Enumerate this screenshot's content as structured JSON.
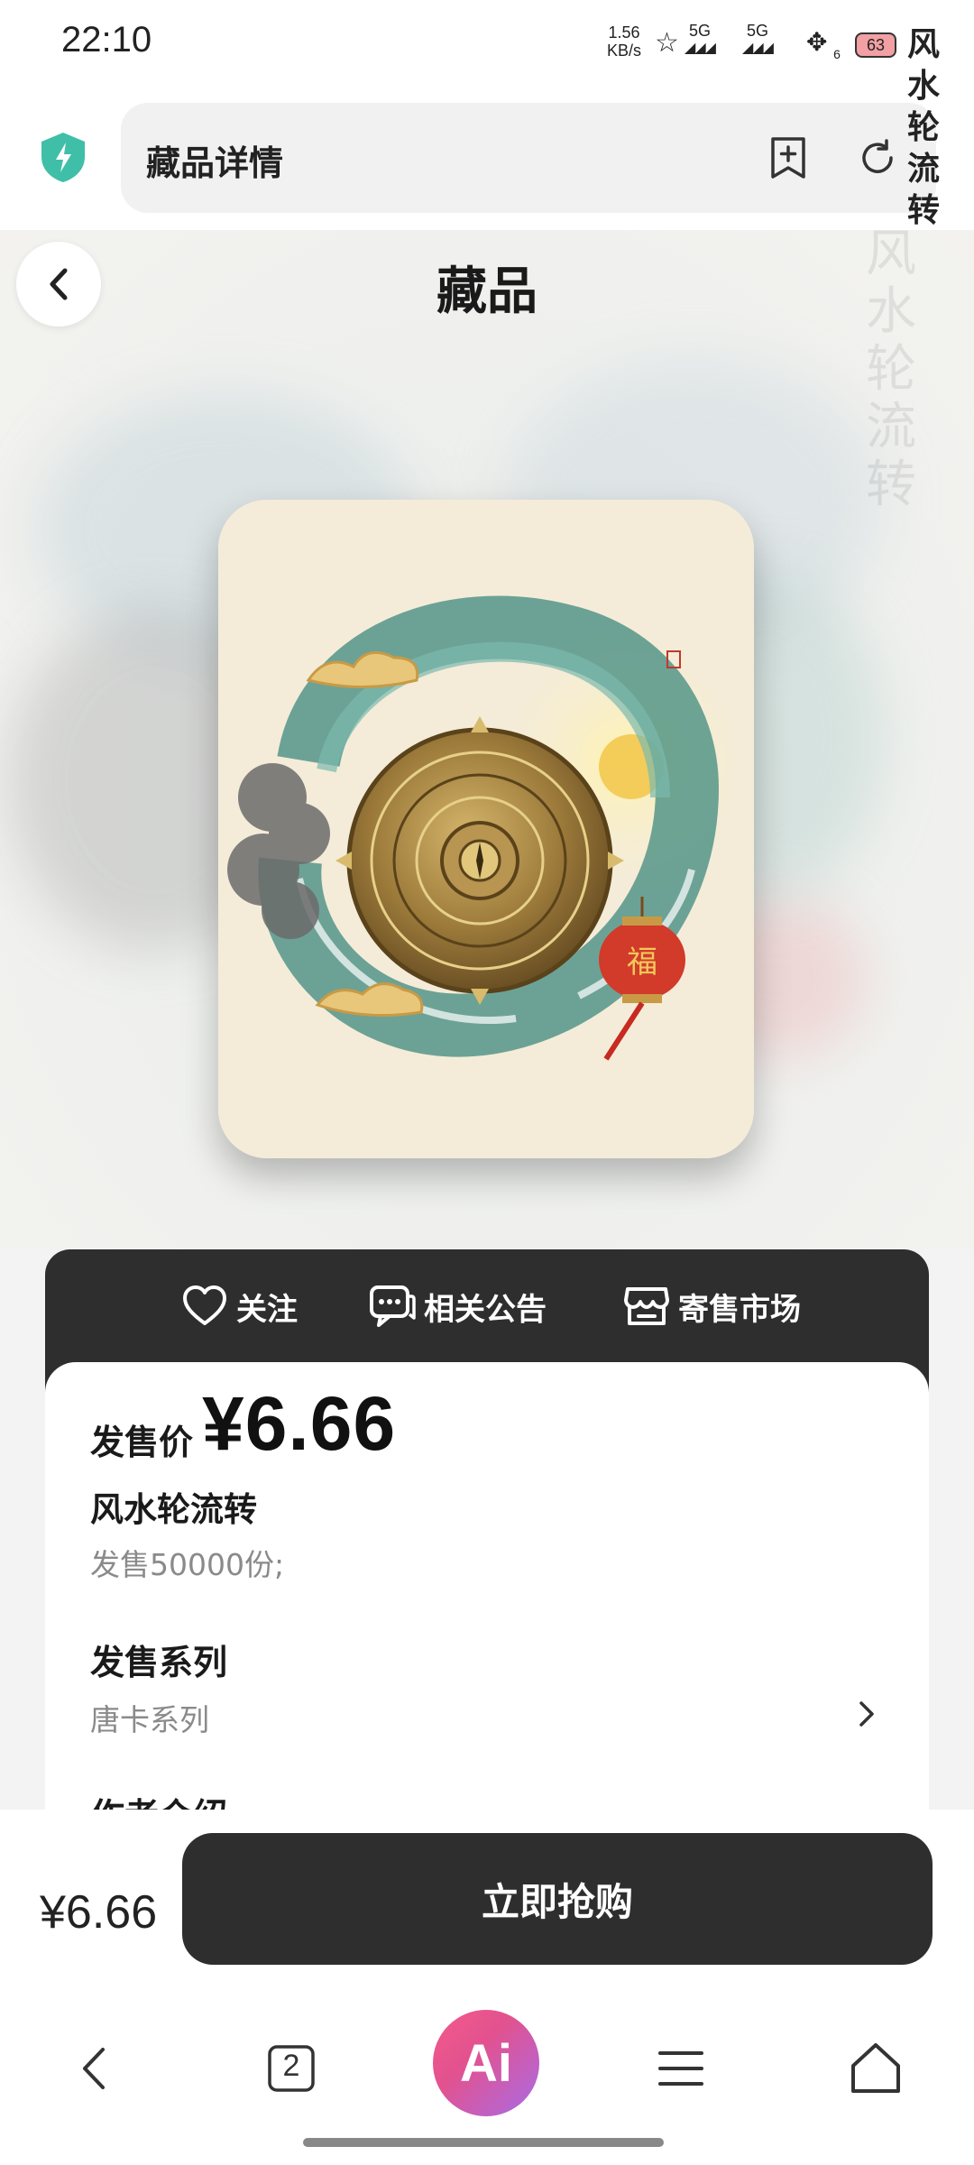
{
  "status_bar": {
    "time": "22:10",
    "speed_value": "1.56",
    "speed_unit": "KB/s",
    "net1": "5G",
    "net2": "5G",
    "sub_count": "6",
    "battery": "63"
  },
  "browser": {
    "title": "藏品详情",
    "icons": [
      "shield-bolt-icon",
      "bookmark-add-icon",
      "refresh-icon"
    ]
  },
  "page": {
    "title": "藏品",
    "bg_watermark": "风水轮流转",
    "card_title": "风水轮流转",
    "card_stamp": "印"
  },
  "actions": [
    {
      "label": "关注",
      "icon": "heart-icon"
    },
    {
      "label": "相关公告",
      "icon": "chat-bubble-icon"
    },
    {
      "label": "寄售市场",
      "icon": "shop-icon"
    }
  ],
  "info": {
    "price_label": "发售价",
    "price": "¥6.66",
    "name": "风水轮流转",
    "count": "发售50000份;",
    "series_label": "发售系列",
    "series_value": "唐卡系列",
    "author_label": "作者介绍"
  },
  "buy": {
    "price": "¥6.66",
    "button": "立即抢购"
  },
  "nav": {
    "tabs_count": "2",
    "ai_label": "Ai",
    "icons": [
      "back-icon",
      "tabs-icon",
      "ai-icon",
      "menu-icon",
      "home-icon"
    ]
  },
  "colors": {
    "dark": "#2e2e2e",
    "accent_teal": "#3fbfa7",
    "ai_gradient_start": "#f45a8a",
    "ai_gradient_end": "#a86ce8"
  }
}
